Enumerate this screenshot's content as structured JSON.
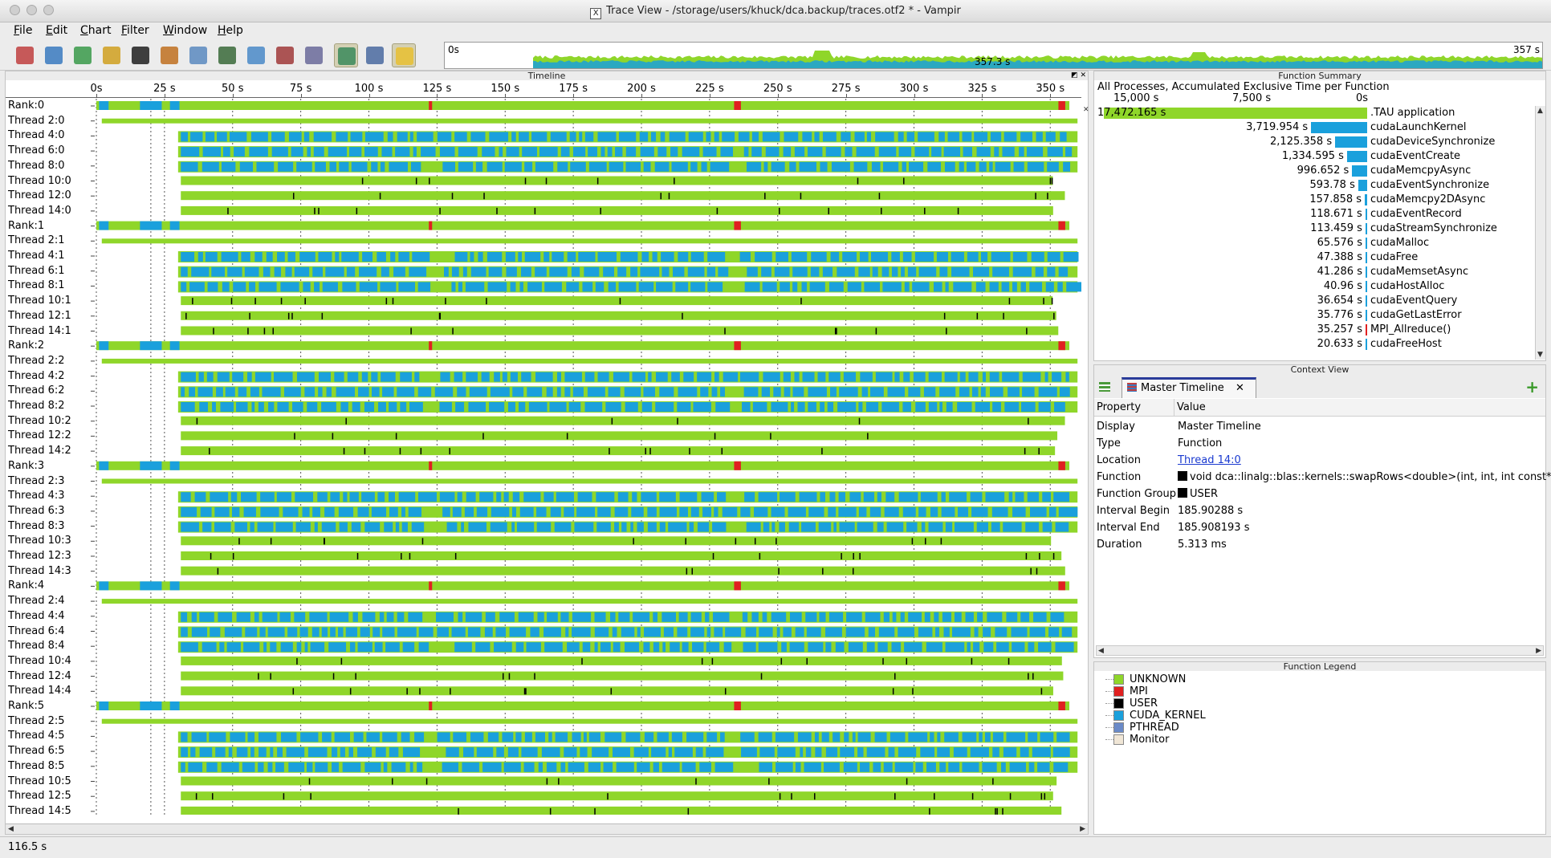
{
  "window": {
    "title": "Trace View - /storage/users/khuck/dca.backup/traces.otf2 * - Vampir",
    "title_icon": "X"
  },
  "menu": [
    "File",
    "Edit",
    "Chart",
    "Filter",
    "Window",
    "Help"
  ],
  "toolbar": {
    "buttons": [
      {
        "icon": "master-timeline-icon",
        "color": "#c04040"
      },
      {
        "icon": "process-timeline-icon",
        "color": "#3a7ac0"
      },
      {
        "icon": "counter-timeline-icon",
        "color": "#3a9a4a"
      },
      {
        "icon": "performance-radar-icon",
        "color": "#d0a020"
      },
      {
        "icon": "function-summary-icon",
        "color": "#202020"
      },
      {
        "icon": "message-summary-icon",
        "color": "#c07020"
      },
      {
        "icon": "process-summary-icon",
        "color": "#5a8ac0"
      },
      {
        "icon": "communication-matrix-icon",
        "color": "#3a6a3a"
      },
      {
        "icon": "io-summary-icon",
        "color": "#4a8ac8"
      },
      {
        "icon": "call-tree-icon",
        "color": "#a03a3a"
      },
      {
        "icon": "function-legend-icon",
        "color": "#6a6a9a"
      },
      {
        "icon": "zoom-mode-icon",
        "color": "#3a8a5a"
      },
      {
        "icon": "pin-icon",
        "color": "#4a6aa0"
      },
      {
        "icon": "lightbulb-icon",
        "color": "#e8c030"
      }
    ],
    "overview": {
      "start": "0s",
      "end": "357 s",
      "duration": "357.3 s"
    }
  },
  "timeline": {
    "title": "Timeline",
    "ticks": [
      "0s",
      "25 s",
      "50 s",
      "75 s",
      "100 s",
      "125 s",
      "150 s",
      "175 s",
      "200 s",
      "225 s",
      "250 s",
      "275 s",
      "300 s",
      "325 s",
      "350 s"
    ],
    "rows": [
      "Rank:0",
      "Thread 2:0",
      "Thread 4:0",
      "Thread 6:0",
      "Thread 8:0",
      "Thread 10:0",
      "Thread 12:0",
      "Thread 14:0",
      "Rank:1",
      "Thread 2:1",
      "Thread 4:1",
      "Thread 6:1",
      "Thread 8:1",
      "Thread 10:1",
      "Thread 12:1",
      "Thread 14:1",
      "Rank:2",
      "Thread 2:2",
      "Thread 4:2",
      "Thread 6:2",
      "Thread 8:2",
      "Thread 10:2",
      "Thread 12:2",
      "Thread 14:2",
      "Rank:3",
      "Thread 2:3",
      "Thread 4:3",
      "Thread 6:3",
      "Thread 8:3",
      "Thread 10:3",
      "Thread 12:3",
      "Thread 14:3",
      "Rank:4",
      "Thread 2:4",
      "Thread 4:4",
      "Thread 6:4",
      "Thread 8:4",
      "Thread 10:4",
      "Thread 12:4",
      "Thread 14:4",
      "Rank:5",
      "Thread 2:5",
      "Thread 4:5",
      "Thread 6:5",
      "Thread 8:5",
      "Thread 10:5",
      "Thread 12:5",
      "Thread 14:5"
    ]
  },
  "summary": {
    "title": "Function Summary",
    "subtitle": "All Processes, Accumulated Exclusive Time per Function",
    "axis": [
      "15,000 s",
      "7,500 s",
      "0s"
    ],
    "max": 17472.165,
    "rows": [
      {
        "value": "17,472.165 s",
        "seconds": 17472.165,
        "name": ".TAU application",
        "color": "#8fd62a"
      },
      {
        "value": "3,719.954 s",
        "seconds": 3719.954,
        "name": "cudaLaunchKernel",
        "color": "#1aa0dc"
      },
      {
        "value": "2,125.358 s",
        "seconds": 2125.358,
        "name": "cudaDeviceSynchronize",
        "color": "#1aa0dc"
      },
      {
        "value": "1,334.595 s",
        "seconds": 1334.595,
        "name": "cudaEventCreate",
        "color": "#1aa0dc"
      },
      {
        "value": "996.652 s",
        "seconds": 996.652,
        "name": "cudaMemcpyAsync",
        "color": "#1aa0dc"
      },
      {
        "value": "593.78 s",
        "seconds": 593.78,
        "name": "cudaEventSynchronize",
        "color": "#1aa0dc"
      },
      {
        "value": "157.858 s",
        "seconds": 157.858,
        "name": "cudaMemcpy2DAsync",
        "color": "#1aa0dc"
      },
      {
        "value": "118.671 s",
        "seconds": 118.671,
        "name": "cudaEventRecord",
        "color": "#1aa0dc"
      },
      {
        "value": "113.459 s",
        "seconds": 113.459,
        "name": "cudaStreamSynchronize",
        "color": "#1aa0dc"
      },
      {
        "value": "65.576 s",
        "seconds": 65.576,
        "name": "cudaMalloc",
        "color": "#1aa0dc"
      },
      {
        "value": "47.388 s",
        "seconds": 47.388,
        "name": "cudaFree",
        "color": "#1aa0dc"
      },
      {
        "value": "41.286 s",
        "seconds": 41.286,
        "name": "cudaMemsetAsync",
        "color": "#1aa0dc"
      },
      {
        "value": "40.96 s",
        "seconds": 40.96,
        "name": "cudaHostAlloc",
        "color": "#1aa0dc"
      },
      {
        "value": "36.654 s",
        "seconds": 36.654,
        "name": "cudaEventQuery",
        "color": "#1aa0dc"
      },
      {
        "value": "35.776 s",
        "seconds": 35.776,
        "name": "cudaGetLastError",
        "color": "#1aa0dc"
      },
      {
        "value": "35.257 s",
        "seconds": 35.257,
        "name": "MPI_Allreduce()",
        "color": "#e02020"
      },
      {
        "value": "20.633 s",
        "seconds": 20.633,
        "name": "cudaFreeHost",
        "color": "#1aa0dc"
      }
    ]
  },
  "context": {
    "title": "Context View",
    "tab_label": "Master Timeline",
    "headers": [
      "Property",
      "Value"
    ],
    "rows": [
      {
        "prop": "Display",
        "value": "Master Timeline"
      },
      {
        "prop": "Type",
        "value": "Function"
      },
      {
        "prop": "Location",
        "value": "Thread 14:0",
        "link": true
      },
      {
        "prop": "Function",
        "value": "void dca::linalg::blas::kernels::swapRows<double>(int, int, int const*,",
        "swatch": "#000000"
      },
      {
        "prop": "Function Group",
        "value": "USER",
        "swatch": "#000000"
      },
      {
        "prop": "Interval Begin",
        "value": "185.90288 s"
      },
      {
        "prop": "Interval End",
        "value": "185.908193 s"
      },
      {
        "prop": "Duration",
        "value": "5.313 ms"
      }
    ]
  },
  "legend": {
    "title": "Function Legend",
    "items": [
      {
        "name": "UNKNOWN",
        "color": "#8fd62a"
      },
      {
        "name": "MPI",
        "color": "#e02020"
      },
      {
        "name": "USER",
        "color": "#000000"
      },
      {
        "name": "CUDA_KERNEL",
        "color": "#1aa0dc"
      },
      {
        "name": "PTHREAD",
        "color": "#6a8ac8"
      },
      {
        "name": "Monitor",
        "color": "#f0e6d6"
      }
    ]
  },
  "status": {
    "text": "116.5 s"
  },
  "colors": {
    "unknown": "#8fd62a",
    "cuda": "#1aa0dc",
    "mpi": "#e02020",
    "user": "#000000"
  }
}
